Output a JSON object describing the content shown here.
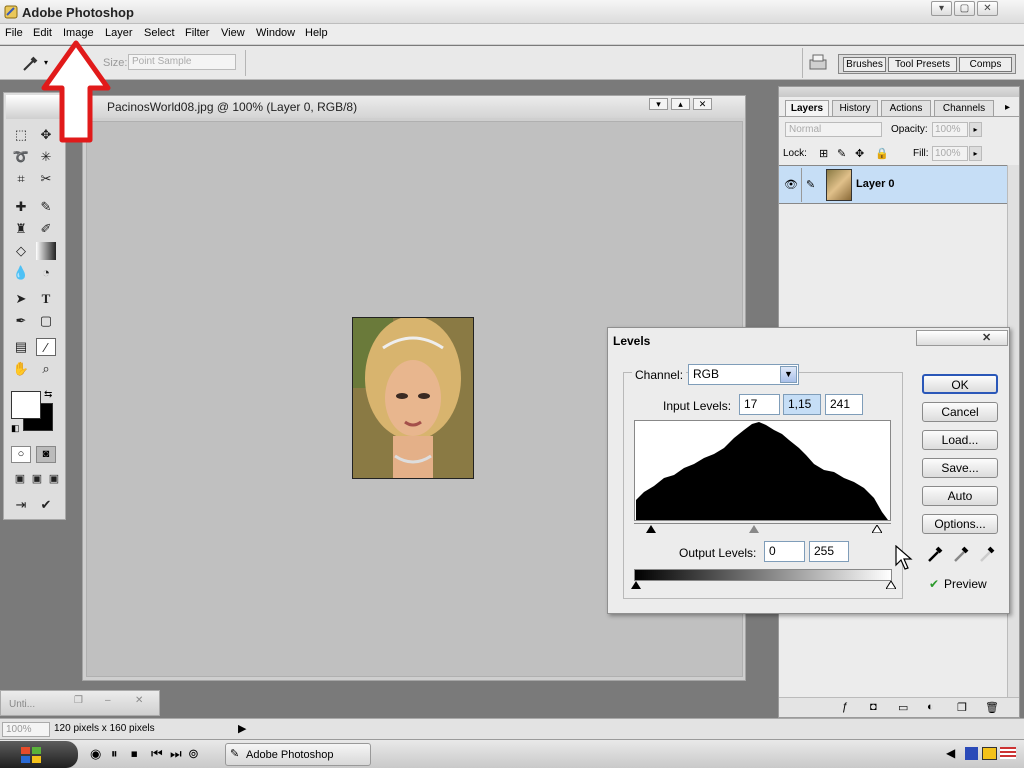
{
  "app": {
    "title": "Adobe Photoshop"
  },
  "window_buttons": [
    "▾",
    "▢",
    "✕"
  ],
  "menu": [
    "File",
    "Edit",
    "Image",
    "Layer",
    "Select",
    "Filter",
    "View",
    "Window",
    "Help"
  ],
  "options_bar": {
    "sample_size_label": "Size:",
    "sample_size_value": "Point Sample",
    "palette_tabs": [
      "Brushes",
      "Tool Presets",
      "Comps"
    ]
  },
  "document": {
    "title": "PacinosWorld08.jpg @ 100% (Layer 0, RGB/8)",
    "controls": [
      "▾",
      "▴",
      "✕"
    ]
  },
  "minimized_doc": {
    "title": "Unti..."
  },
  "layers_panel": {
    "tabs": [
      "Layers",
      "History",
      "Actions",
      "Channels"
    ],
    "blend_mode": "Normal",
    "opacity_label": "Opacity:",
    "opacity_value": "100%",
    "lock_label": "Lock:",
    "fill_label": "Fill:",
    "fill_value": "100%",
    "layer_name": "Layer 0"
  },
  "levels": {
    "title": "Levels",
    "channel_label": "Channel:",
    "channel_value": "RGB",
    "input_levels_label": "Input Levels:",
    "input_black": "17",
    "input_gamma": "1,15",
    "input_white": "241",
    "output_levels_label": "Output Levels:",
    "output_black": "0",
    "output_white": "255",
    "buttons": {
      "ok": "OK",
      "cancel": "Cancel",
      "load": "Load...",
      "save": "Save...",
      "auto": "Auto",
      "options": "Options..."
    },
    "preview_label": "Preview",
    "preview_checked": true
  },
  "status": {
    "zoom": "100%",
    "info": "120 pixels x 160 pixels"
  },
  "taskbar": {
    "task_label": "Adobe Photoshop"
  },
  "colors": {
    "accent_selected": "#c6def6",
    "arrow_red": "#e11a1a"
  }
}
